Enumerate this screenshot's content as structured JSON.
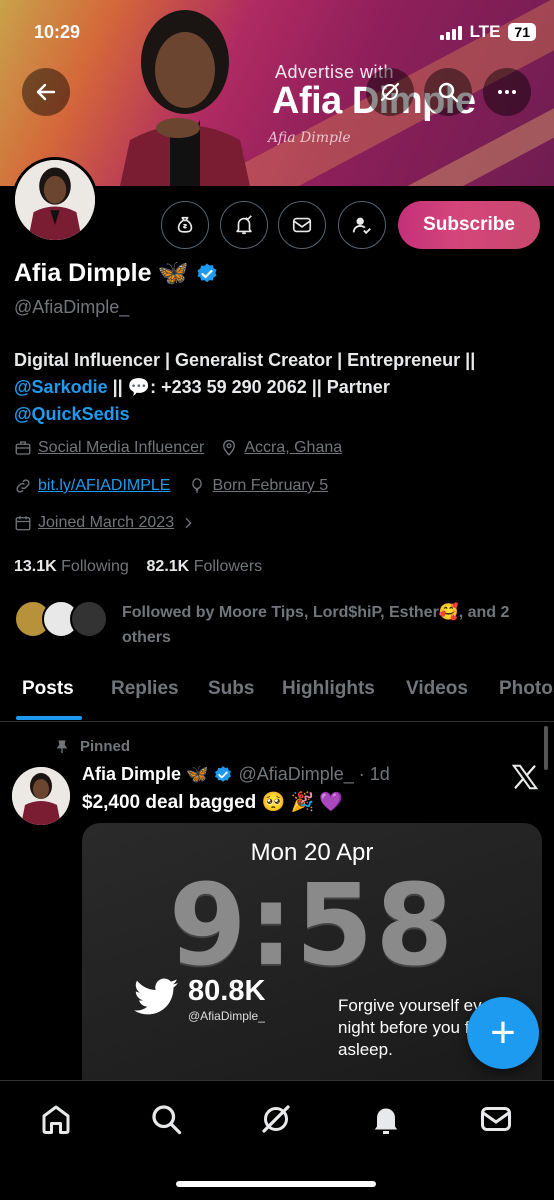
{
  "status_bar": {
    "time": "10:29",
    "network": "LTE",
    "battery": "71"
  },
  "banner": {
    "advertise": "Advertise with",
    "brand": "Afia Dimple",
    "signature": "Afia Dimple"
  },
  "header_actions": {
    "subscribe_label": "Subscribe"
  },
  "profile": {
    "name": "Afia Dimple",
    "name_emoji": "🦋",
    "handle": "@AfiaDimple_",
    "bio_line1": "Digital Influencer | Generalist Creator | Entrepreneur ||",
    "bio_mention1": "@Sarkodie",
    "bio_mid": " || 💬: +233 59 290 2062 || Partner",
    "bio_mention2": "@QuickSedis",
    "category": "Social Media Influencer",
    "location": "Accra, Ghana",
    "website": "bit.ly/AFIADIMPLE",
    "birthday": "Born February 5",
    "joined": "Joined March 2023",
    "following_count": "13.1K",
    "following_label": "Following",
    "followers_count": "82.1K",
    "followers_label": "Followers",
    "followed_by": "Followed by Moore Tips, Lord$hiP, Esther🥰, and 2 others"
  },
  "tabs": [
    "Posts",
    "Replies",
    "Subs",
    "Highlights",
    "Videos",
    "Photos"
  ],
  "post": {
    "pinned_label": "Pinned",
    "author": "Afia Dimple",
    "author_emoji": "🦋",
    "handle_time": "@AfiaDimple_ · 1d",
    "text": "$2,400 deal bagged 🥺 🎉 💜",
    "media": {
      "date": "Mon 20 Apr",
      "clock": "9:58",
      "stat": "80.8K",
      "stat_handle": "@AfiaDimple_",
      "quote": "Forgive yourself every night before you fall asleep."
    }
  },
  "colors": {
    "accent": "#1d9bf0",
    "subscribe": "#c9407a",
    "muted": "#71767b"
  }
}
